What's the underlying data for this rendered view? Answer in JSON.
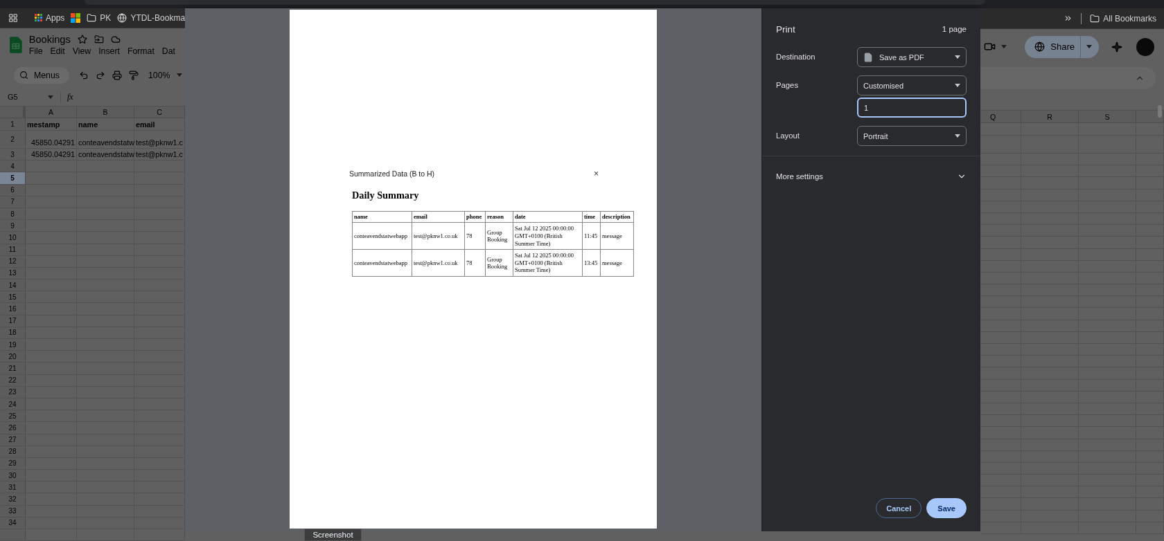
{
  "browser": {
    "bookmarks": [
      {
        "kind": "apps",
        "label": "Apps"
      },
      {
        "kind": "tiles"
      },
      {
        "kind": "folder",
        "label": "PK"
      },
      {
        "kind": "site",
        "label": "YTDL-Bookma"
      }
    ],
    "all_bookmarks": "All Bookmarks"
  },
  "sheet": {
    "title": "Bookings",
    "menus": [
      "File",
      "Edit",
      "View",
      "Insert",
      "Format",
      "Dat"
    ],
    "search_placeholder": "Menus",
    "zoom": "100%",
    "name_box": "G5",
    "formula_label": "fx",
    "share": "Share",
    "columns_left": [
      "A",
      "B",
      "C"
    ],
    "columns_right": [
      "Q",
      "R",
      "S"
    ],
    "rows": [
      {
        "number": "1",
        "selected": false,
        "kind": "header",
        "cells": [
          "mestamp",
          "name",
          "email"
        ]
      },
      {
        "number": "2",
        "selected": false,
        "kind": "data",
        "cells": [
          "45850.04291",
          "conteavendstatw",
          "test@pknw1.c"
        ]
      },
      {
        "number": "3",
        "selected": false,
        "kind": "data",
        "cells": [
          "45850.04291",
          "conteavendstatw",
          "test@pknw1.c"
        ]
      },
      {
        "number": "4",
        "selected": false
      },
      {
        "number": "5",
        "selected": true
      },
      {
        "number": "6",
        "selected": false
      },
      {
        "number": "7",
        "selected": false
      },
      {
        "number": "8",
        "selected": false
      },
      {
        "number": "9",
        "selected": false
      },
      {
        "number": "10",
        "selected": false
      },
      {
        "number": "11",
        "selected": false
      },
      {
        "number": "12",
        "selected": false
      },
      {
        "number": "13",
        "selected": false
      },
      {
        "number": "14",
        "selected": false
      },
      {
        "number": "15",
        "selected": false
      },
      {
        "number": "16",
        "selected": false
      },
      {
        "number": "17",
        "selected": false
      },
      {
        "number": "18",
        "selected": false
      },
      {
        "number": "19",
        "selected": false
      },
      {
        "number": "20",
        "selected": false
      },
      {
        "number": "21",
        "selected": false
      },
      {
        "number": "22",
        "selected": false
      },
      {
        "number": "23",
        "selected": false
      },
      {
        "number": "24",
        "selected": false
      },
      {
        "number": "25",
        "selected": false
      },
      {
        "number": "26",
        "selected": false
      },
      {
        "number": "27",
        "selected": false
      },
      {
        "number": "28",
        "selected": false
      },
      {
        "number": "29",
        "selected": false
      },
      {
        "number": "30",
        "selected": false
      },
      {
        "number": "31",
        "selected": false
      },
      {
        "number": "32",
        "selected": false
      },
      {
        "number": "33",
        "selected": false
      },
      {
        "number": "34",
        "selected": false
      }
    ]
  },
  "preview": {
    "dialog_title": "Summarized Data (B to H)",
    "close": "×",
    "heading": "Daily Summary",
    "table": {
      "columns": [
        "name",
        "email",
        "phone",
        "reason",
        "date",
        "time",
        "description"
      ],
      "rows": [
        [
          "conteavendstatwebapp",
          "test@pknw1.co.uk",
          "78",
          "Group Booking",
          "Sat Jul 12 2025 00:00:00 GMT+0100 (British Summer Time)",
          "11:45",
          "message"
        ],
        [
          "conteavendstatwebapp",
          "test@pknw1.co.uk",
          "78",
          "Group Booking",
          "Sat Jul 12 2025 00:00:00 GMT+0100 (British Summer Time)",
          "13:45",
          "message"
        ]
      ]
    }
  },
  "print": {
    "title": "Print",
    "page_count": "1 page",
    "settings": [
      {
        "kind": "destination",
        "label": "Destination",
        "value": "Save as PDF"
      },
      {
        "kind": "pages",
        "label": "Pages",
        "value": "Customised",
        "input": {
          "value": "1",
          "focused": true
        }
      },
      {
        "kind": "select",
        "label": "Layout",
        "value": "Portrait"
      }
    ],
    "more_settings": {
      "label": "More settings",
      "expanded": false
    },
    "buttons": [
      {
        "kind": "secondary",
        "label": "Cancel"
      },
      {
        "kind": "primary",
        "label": "Save"
      }
    ]
  },
  "tooltip": "Screenshot"
}
